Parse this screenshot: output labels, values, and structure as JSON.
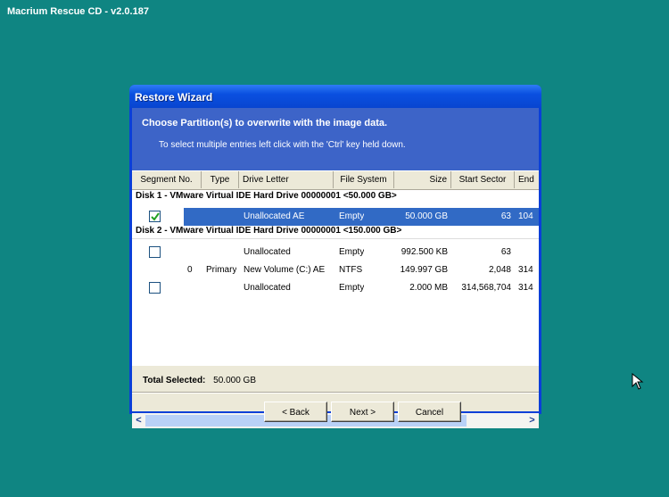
{
  "app_title": "Macrium Rescue CD - v2.0.187",
  "window": {
    "title": "Restore Wizard",
    "heading": "Choose  Partition(s)  to overwrite with the image data.",
    "subheading": "To select multiple entries left click with the 'Ctrl' key held down."
  },
  "columns": [
    "Segment No.",
    "Type",
    "Drive Letter",
    "File System",
    "Size",
    "Start Sector",
    "End"
  ],
  "disks": [
    {
      "label": "Disk 1 - VMware Virtual IDE Hard Drive 00000001  <50.000 GB>",
      "rows": [
        {
          "checkbox": true,
          "checked": true,
          "selected": true,
          "segment": "",
          "type": "",
          "drive": "Unallocated  AE",
          "fs": "Empty",
          "size": "50.000 GB",
          "start": "63",
          "end": "104"
        }
      ]
    },
    {
      "label": "Disk 2 - VMware Virtual IDE Hard Drive 00000001  <150.000 GB>",
      "rows": [
        {
          "checkbox": true,
          "checked": false,
          "selected": false,
          "segment": "",
          "type": "",
          "drive": "Unallocated",
          "fs": "Empty",
          "size": "992.500 KB",
          "start": "63",
          "end": ""
        },
        {
          "checkbox": false,
          "checked": false,
          "selected": false,
          "segment": "0",
          "type": "Primary",
          "drive": "New Volume (C:)  AE",
          "fs": "NTFS",
          "size": "149.997 GB",
          "start": "2,048",
          "end": "314"
        },
        {
          "checkbox": true,
          "checked": false,
          "selected": false,
          "segment": "",
          "type": "",
          "drive": "Unallocated",
          "fs": "Empty",
          "size": "2.000 MB",
          "start": "314,568,704",
          "end": "314"
        }
      ]
    }
  ],
  "scroll": {
    "left_arrow": "<",
    "right_arrow": ">"
  },
  "total": {
    "label": "Total Selected:",
    "value": "50.000 GB"
  },
  "buttons": {
    "back": "< Back",
    "next": "Next >",
    "cancel": "Cancel"
  }
}
